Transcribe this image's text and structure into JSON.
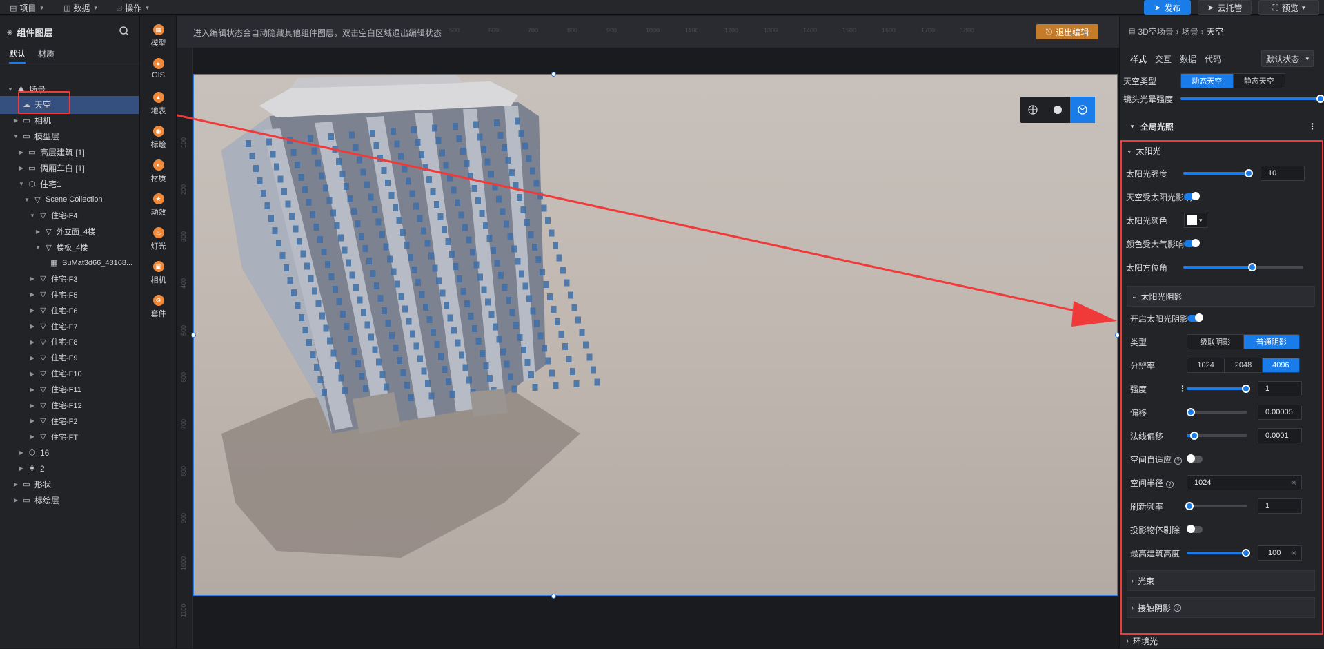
{
  "topbar": {
    "menus": [
      {
        "label": "项目",
        "icon": "document-icon"
      },
      {
        "label": "数据",
        "icon": "database-icon"
      },
      {
        "label": "操作",
        "icon": "grid-icon"
      }
    ],
    "publish_label": "发布",
    "cloud_label": "云托管",
    "preview_label": "预览"
  },
  "layers": {
    "title": "组件图层",
    "tabs": [
      "默认",
      "材质"
    ],
    "tree": [
      {
        "label": "场景",
        "depth": 0,
        "icon": "scene-icon",
        "arrow": "open"
      },
      {
        "label": "天空",
        "depth": 1,
        "icon": "sky-icon",
        "arrow": "none",
        "selected": true
      },
      {
        "label": "相机",
        "depth": 1,
        "icon": "folder-icon",
        "arrow": "closed"
      },
      {
        "label": "模型层",
        "depth": 1,
        "icon": "folder-icon",
        "arrow": "open"
      },
      {
        "label": "高层建筑 [1]",
        "depth": 2,
        "icon": "folder-icon",
        "arrow": "closed"
      },
      {
        "label": "俩厢车白 [1]",
        "depth": 2,
        "icon": "folder-icon",
        "arrow": "closed"
      },
      {
        "label": "住宅1",
        "depth": 2,
        "icon": "cube-icon",
        "arrow": "open"
      },
      {
        "label": "Scene Collection",
        "depth": 3,
        "icon": "triangle-icon",
        "arrow": "open"
      },
      {
        "label": "住宅-F4",
        "depth": 4,
        "icon": "triangle-icon",
        "arrow": "open"
      },
      {
        "label": "外立面_4楼",
        "depth": 5,
        "icon": "triangle-icon",
        "arrow": "closed"
      },
      {
        "label": "楼板_4楼",
        "depth": 5,
        "icon": "triangle-icon",
        "arrow": "open"
      },
      {
        "label": "SuMat3d66_43168...",
        "depth": 6,
        "icon": "checker-icon",
        "arrow": "none"
      },
      {
        "label": "住宅-F3",
        "depth": 4,
        "icon": "triangle-icon",
        "arrow": "closed"
      },
      {
        "label": "住宅-F5",
        "depth": 4,
        "icon": "triangle-icon",
        "arrow": "closed"
      },
      {
        "label": "住宅-F6",
        "depth": 4,
        "icon": "triangle-icon",
        "arrow": "closed"
      },
      {
        "label": "住宅-F7",
        "depth": 4,
        "icon": "triangle-icon",
        "arrow": "closed"
      },
      {
        "label": "住宅-F8",
        "depth": 4,
        "icon": "triangle-icon",
        "arrow": "closed"
      },
      {
        "label": "住宅-F9",
        "depth": 4,
        "icon": "triangle-icon",
        "arrow": "closed"
      },
      {
        "label": "住宅-F10",
        "depth": 4,
        "icon": "triangle-icon",
        "arrow": "closed"
      },
      {
        "label": "住宅-F11",
        "depth": 4,
        "icon": "triangle-icon",
        "arrow": "closed"
      },
      {
        "label": "住宅-F12",
        "depth": 4,
        "icon": "triangle-icon",
        "arrow": "closed"
      },
      {
        "label": "住宅-F2",
        "depth": 4,
        "icon": "triangle-icon",
        "arrow": "closed"
      },
      {
        "label": "住宅-FT",
        "depth": 4,
        "icon": "triangle-icon",
        "arrow": "closed"
      },
      {
        "label": "16",
        "depth": 2,
        "icon": "cube-icon",
        "arrow": "closed"
      },
      {
        "label": "2",
        "depth": 2,
        "icon": "asterisk-icon",
        "arrow": "closed"
      },
      {
        "label": "形状",
        "depth": 1,
        "icon": "folder-icon",
        "arrow": "closed"
      },
      {
        "label": "标绘层",
        "depth": 1,
        "icon": "folder-icon",
        "arrow": "closed"
      }
    ]
  },
  "components": [
    {
      "label": "模型",
      "icon": "model-icon"
    },
    {
      "label": "GIS",
      "icon": "gis-icon"
    },
    {
      "label": "地表",
      "icon": "terrain-icon"
    },
    {
      "label": "标绘",
      "icon": "pin-icon"
    },
    {
      "label": "材质",
      "icon": "material-icon"
    },
    {
      "label": "动效",
      "icon": "effect-icon"
    },
    {
      "label": "灯光",
      "icon": "light-icon"
    },
    {
      "label": "相机",
      "icon": "camera-icon"
    },
    {
      "label": "套件",
      "icon": "kit-icon"
    }
  ],
  "canvas": {
    "hint": "进入编辑状态会自动隐藏其他组件图层，双击空白区域退出编辑状态",
    "exit_label": "退出编辑",
    "ruler_top": [
      "400",
      "500",
      "600",
      "700",
      "800",
      "900",
      "1000",
      "1100",
      "1200",
      "1300",
      "1400",
      "1500",
      "1600",
      "1700",
      "1800"
    ],
    "ruler_left": [
      "100",
      "200",
      "300",
      "400",
      "500",
      "600",
      "700",
      "800",
      "900",
      "1000",
      "1100"
    ]
  },
  "props": {
    "breadcrumb": [
      "3D空场景",
      "场景",
      "天空"
    ],
    "tabs": [
      "样式",
      "交互",
      "数据",
      "代码"
    ],
    "state": "默认状态",
    "sky_type_label": "天空类型",
    "sky_type_options": [
      "动态天空",
      "静态天空"
    ],
    "sky_type_selected": 0,
    "lens_flare_label": "镜头光晕强度",
    "lens_flare_value": 1.0,
    "global_light": "全局光照",
    "sun_section": "太阳光",
    "sun_intensity_label": "太阳光强度",
    "sun_intensity_value": "10",
    "sun_intensity_level": 0.95,
    "sky_sun_affect_label": "天空受太阳光影响",
    "sky_sun_affect": true,
    "sun_color_label": "太阳光颜色",
    "sun_color": "#ffffff",
    "atmos_affect_label": "颜色受大气影响",
    "atmos_affect": true,
    "sun_azimuth_label": "太阳方位角",
    "sun_azimuth_level": 0.57,
    "shadow_section": "太阳光阴影",
    "shadow_enable_label": "开启太阳光阴影",
    "shadow_enable": true,
    "type_label": "类型",
    "type_options": [
      "级联阴影",
      "普通阴影"
    ],
    "type_selected": 1,
    "resolution_label": "分辨率",
    "resolution_options": [
      "1024",
      "2048",
      "4096"
    ],
    "resolution_selected": 2,
    "strength_label": "强度",
    "strength_value": "1",
    "strength_level": 1.0,
    "offset_label": "偏移",
    "offset_value": "0.00005",
    "offset_level": 0.03,
    "normal_offset_label": "法线偏移",
    "normal_offset_value": "0.0001",
    "normal_offset_level": 0.08,
    "adaptive_label": "空间自适应",
    "adaptive": false,
    "radius_label": "空间半径",
    "radius_value": "1024",
    "refresh_label": "刷新频率",
    "refresh_value": "1",
    "refresh_level": 0.0,
    "cull_label": "投影物体剔除",
    "cull": false,
    "max_height_label": "最高建筑高度",
    "max_height_value": "100",
    "max_height_level": 1.0,
    "beam_section": "光束",
    "contact_shadow_section": "接触阴影",
    "env_light_section": "环境光",
    "accent_color": "#1a7ce8",
    "highlight_color": "#f03a3a"
  }
}
